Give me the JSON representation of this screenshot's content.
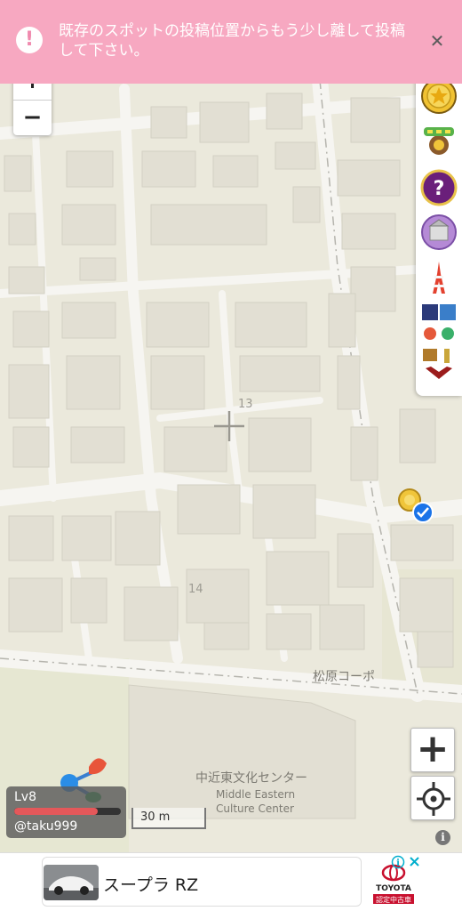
{
  "toast": {
    "message": "既存のスポットの投稿位置からもう少し離して投稿して下さい。",
    "close_icon": "close-icon",
    "alert_icon": "exclamation-icon"
  },
  "zoom": {
    "in_label": "+",
    "out_label": "−"
  },
  "map": {
    "block_numbers": [
      "13",
      "14"
    ],
    "place_labels": [
      "松原コーポ",
      "中近東文化センター",
      "Middle Eastern",
      "Culture Center"
    ]
  },
  "side_panel": {
    "items": [
      "gold-coin-icon",
      "pikkuru-badge-icon",
      "mystery-question-icon",
      "castle-badge-icon",
      "tokyo-tower-icon",
      "character-grid-icon",
      "bull-icon"
    ]
  },
  "controls": {
    "zoom_in_label": "+",
    "locate_icon": "crosshair-icon"
  },
  "player": {
    "level": "Lv8",
    "username": "@taku999",
    "hp_fraction": 0.78
  },
  "scale": {
    "label": "30 m"
  },
  "info_label": "i",
  "ad": {
    "title": "スープラ RZ",
    "logo_line1": "TOYOTA",
    "logo_line2": "認定中古車",
    "choices_icon": "ad-choices-icon"
  },
  "colors": {
    "toast_bg": "#f7a8c1",
    "map_bg": "#ebe9dc",
    "building": "#e2dfd3",
    "hp_fill": "#e4585a",
    "verified_blue": "#1a73e8"
  }
}
